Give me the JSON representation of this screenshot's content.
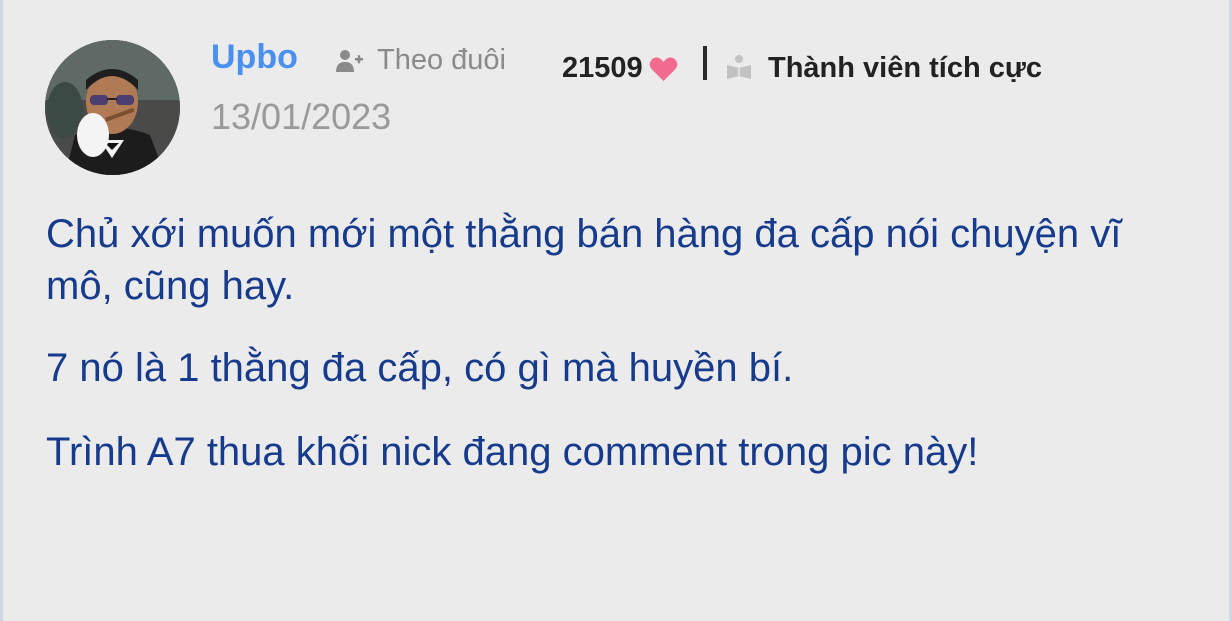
{
  "post": {
    "author": "Upbo",
    "follow_label": "Theo đuôi",
    "date": "13/01/2023",
    "points": "21509",
    "rank": "Thành viên tích cực",
    "paragraphs": [
      "Chủ xới muốn mới một thằng bán hàng đa cấp nói chuyện vĩ mô, cũng hay.",
      "7 nó là 1 thằng đa cấp, có gì mà huyền bí.",
      "Trình A7 thua khối nick đang comment trong pic này!"
    ]
  },
  "icons": {
    "avatar": "avatar-photo",
    "follow": "user-plus-icon",
    "points": "heart-icon",
    "rank": "reading-book-icon"
  },
  "colors": {
    "background": "#ebebeb",
    "username": "#4a90f0",
    "body_text": "#163a8c",
    "muted": "#9a9a9a",
    "heart": "#f06b8d"
  }
}
